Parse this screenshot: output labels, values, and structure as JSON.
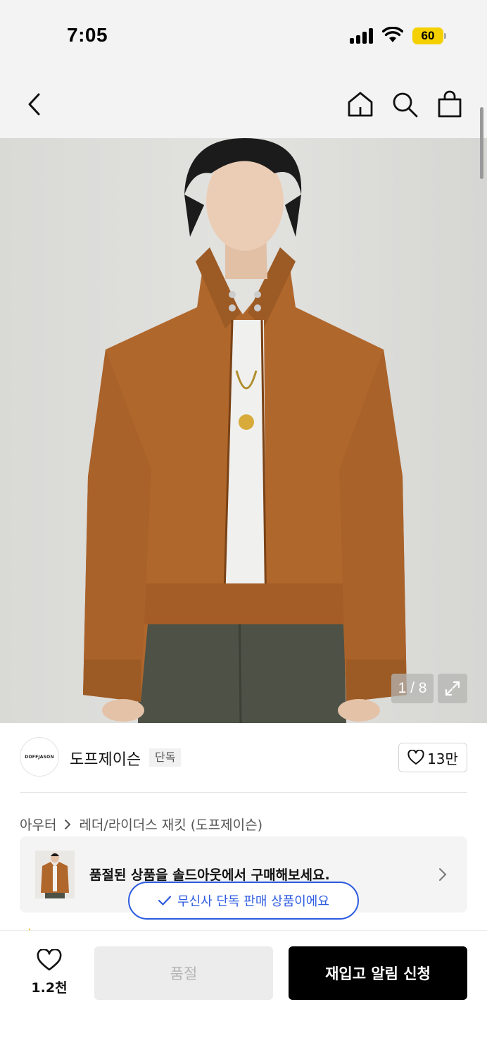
{
  "status_bar": {
    "time": "7:05",
    "battery": "60"
  },
  "nav": {
    "back_icon": "chevron-left-icon",
    "home_icon": "home-icon",
    "search_icon": "search-icon",
    "cart_icon": "shopping-bag-icon"
  },
  "product_image": {
    "counter": "1 / 8",
    "expand_icon": "expand-icon"
  },
  "brand": {
    "logo_text": "DOFFJASON",
    "name": "도프제이슨",
    "badge": "단독",
    "like_count": "13만"
  },
  "breadcrumb": {
    "category": "아우터",
    "subcategory": "레더/라이더스 재킷 (도프제이슨)"
  },
  "soldout_banner": {
    "text": "품절된 상품을 솔드아웃에서 구매해보세요."
  },
  "toast": {
    "text": "무신사 단독 판매 상품이에요"
  },
  "bottom_bar": {
    "wish_count": "1.2천",
    "soldout_label": "품절",
    "restock_label": "재입고 알림 신청"
  },
  "colors": {
    "accent_blue": "#2c5be0",
    "battery_yellow": "#f5d000",
    "primary_black": "#000000",
    "jacket_brown": "#b0672c"
  }
}
